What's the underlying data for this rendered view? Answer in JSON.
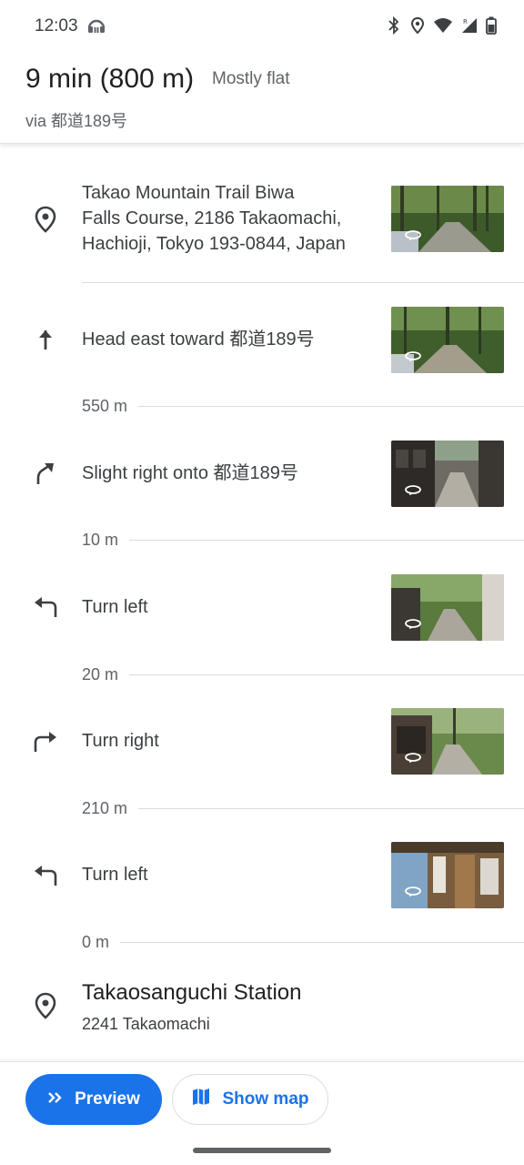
{
  "status_bar": {
    "time": "12:03"
  },
  "header": {
    "duration": "9 min (800 m)",
    "terrain": "Mostly flat",
    "via": "via 都道189号"
  },
  "steps": [
    {
      "icon": "place-marker-icon",
      "text_lines": [
        "Takao Mountain Trail Biwa",
        "Falls Course, 2186 Takaomachi,",
        "Hachioji, Tokyo 193-0844, Japan"
      ]
    },
    {
      "icon": "arrow-up-icon",
      "text": "Head east toward 都道189号",
      "distance": "550 m"
    },
    {
      "icon": "slight-right-icon",
      "text": "Slight right onto 都道189号",
      "distance": "10 m"
    },
    {
      "icon": "turn-left-icon",
      "text": "Turn left",
      "distance": "20 m"
    },
    {
      "icon": "turn-right-icon",
      "text": "Turn right",
      "distance": "210 m"
    },
    {
      "icon": "turn-left-icon",
      "text": "Turn left",
      "distance": "0 m"
    }
  ],
  "destination": {
    "icon": "place-marker-icon",
    "name": "Takaosanguchi Station",
    "address": "2241 Takaomachi"
  },
  "actions": {
    "preview_label": "Preview",
    "show_map_label": "Show map"
  },
  "colors": {
    "accent": "#1a73e8",
    "text_primary": "#202124",
    "text_secondary": "#5f6368",
    "divider": "#dadce0"
  }
}
